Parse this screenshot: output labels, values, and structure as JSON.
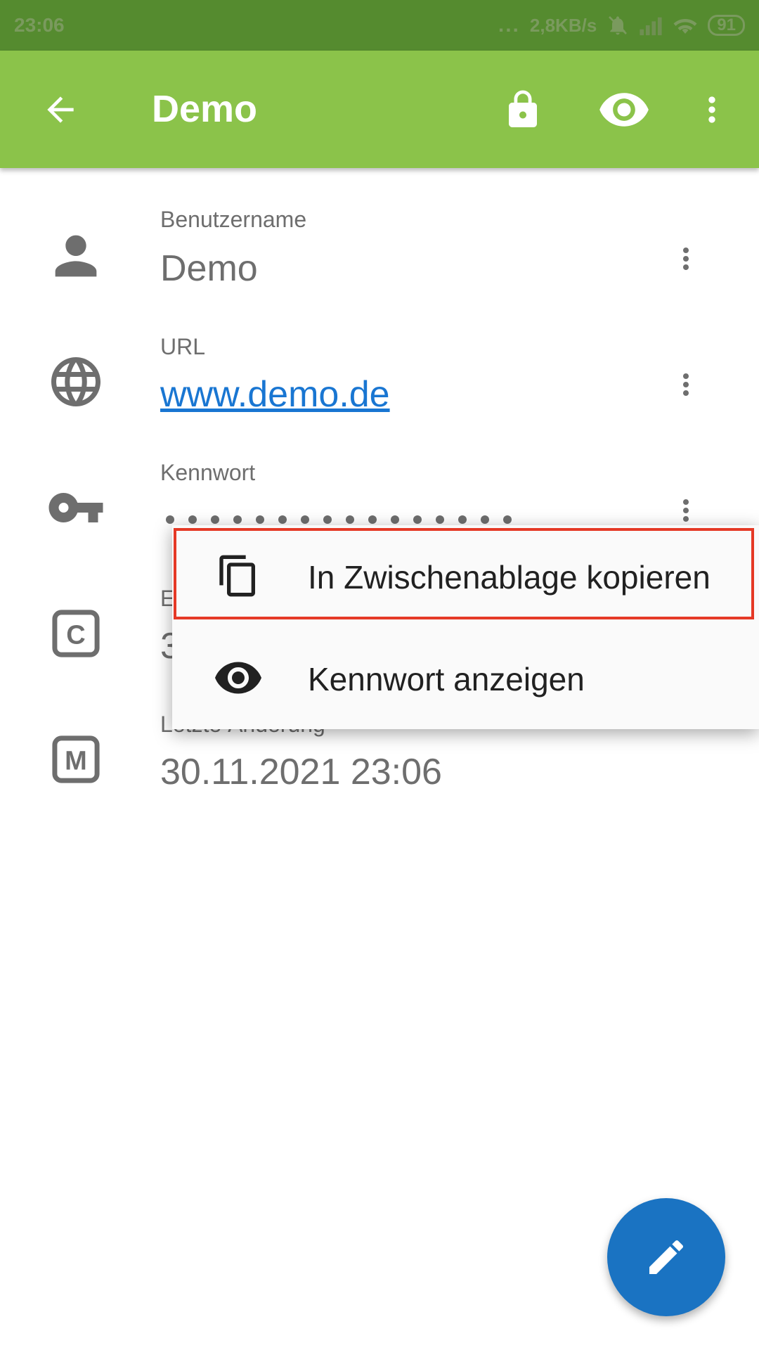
{
  "status_bar": {
    "time": "23:06",
    "dots": "...",
    "speed": "2,8KB/s",
    "battery": "91"
  },
  "app_bar": {
    "title": "Demo",
    "icons": [
      "arrow-back-icon",
      "lock-icon",
      "eye-icon",
      "more-vert-icon"
    ]
  },
  "fields": [
    {
      "label": "Benutzername",
      "value": "Demo",
      "icon": "person-icon"
    },
    {
      "label": "URL",
      "value": "www.demo.de",
      "icon": "globe-icon"
    },
    {
      "label": "Kennwort",
      "value": "",
      "icon": "key-icon",
      "masked_length": 16
    },
    {
      "label": "E",
      "value": "3",
      "icon": "created-c-icon",
      "icon_letter": "C"
    },
    {
      "label": "Letzte Änderung",
      "value": "30.11.2021 23:06",
      "icon": "modified-m-icon",
      "icon_letter": "M"
    }
  ],
  "popup_menu": {
    "items": [
      {
        "label": "In Zwischenablage kopieren",
        "icon": "copy-icon",
        "highlighted": true
      },
      {
        "label": "Kennwort anzeigen",
        "icon": "eye-icon"
      }
    ]
  },
  "fab": {
    "icon": "edit-pencil-icon"
  },
  "colors": {
    "status_bar": "#558b2f",
    "app_bar": "#8bc34a",
    "link": "#1976d2",
    "fab": "#1a73c2",
    "highlight": "#e53926",
    "field_text": "#6e6e6e"
  }
}
